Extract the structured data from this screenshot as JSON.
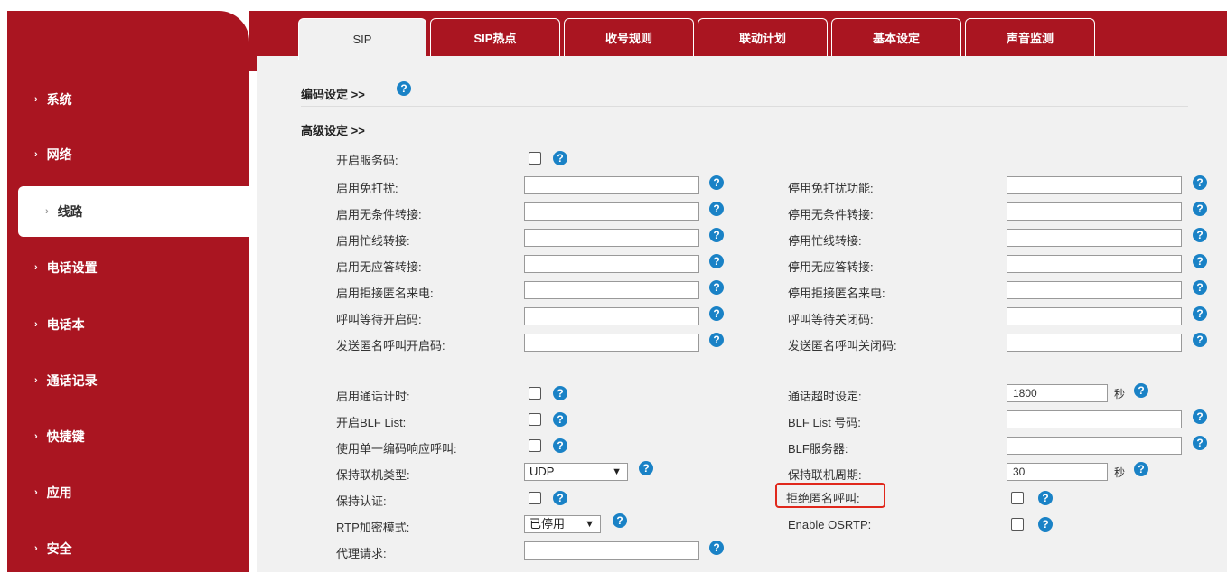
{
  "sidebar": {
    "items": [
      {
        "label": "系统"
      },
      {
        "label": "网络"
      },
      {
        "label": "线路"
      },
      {
        "label": "电话设置"
      },
      {
        "label": "电话本"
      },
      {
        "label": "通话记录"
      },
      {
        "label": "快捷键"
      },
      {
        "label": "应用"
      },
      {
        "label": "安全"
      }
    ],
    "arrow": "›"
  },
  "tabs": [
    {
      "label": "SIP"
    },
    {
      "label": "SIP热点"
    },
    {
      "label": "收号规则"
    },
    {
      "label": "联动计划"
    },
    {
      "label": "基本设定"
    },
    {
      "label": "声音监测"
    }
  ],
  "sections": {
    "codec": "编码设定 >>",
    "advanced": "高级设定 >>"
  },
  "help_glyph": "?",
  "fields": {
    "service_code": "开启服务码:",
    "dnd_on": "启用免打扰:",
    "dnd_off": "停用免打扰功能:",
    "cfu_on": "启用无条件转接:",
    "cfu_off": "停用无条件转接:",
    "cfb_on": "启用忙线转接:",
    "cfb_off": "停用忙线转接:",
    "cfna_on": "启用无应答转接:",
    "cfna_off": "停用无应答转接:",
    "anon_reject_on": "启用拒接匿名来电:",
    "anon_reject_off": "停用拒接匿名来电:",
    "cw_on": "呼叫等待开启码:",
    "cw_off": "呼叫等待关闭码:",
    "anon_send_on": "发送匿名呼叫开启码:",
    "anon_send_off": "发送匿名呼叫关闭码:",
    "call_timer": "启用通话计时:",
    "call_timeout": "通话超时设定:",
    "call_timeout_value": "1800",
    "seconds": "秒",
    "blf_list_on": "开启BLF List:",
    "blf_list_number": "BLF List 号码:",
    "single_codec": "使用单一编码响应呼叫:",
    "blf_server": "BLF服务器:",
    "keepalive_type": "保持联机类型:",
    "keepalive_type_value": "UDP",
    "keepalive_period": "保持联机周期:",
    "keepalive_period_value": "30",
    "keep_auth": "保持认证:",
    "reject_anon_call": "拒绝匿名呼叫:",
    "rtp_encrypt": "RTP加密模式:",
    "rtp_encrypt_value": "已停用",
    "enable_osrtp": "Enable OSRTP:",
    "proxy_require": "代理请求:"
  },
  "colors": {
    "brand": "#aa1521",
    "help": "#1a82c6",
    "highlight": "#e0281c"
  }
}
